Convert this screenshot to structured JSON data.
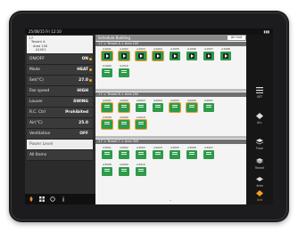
{
  "topbar": {
    "left_text": "25/08/15  Fri  12:10",
    "right_text": "▮▮▮"
  },
  "path": {
    "lines": [
      "1 F",
      "Tenant A",
      "Area 100",
      "A1001"
    ]
  },
  "settings": [
    {
      "key": "ON/OFF",
      "value": "ON"
    },
    {
      "key": "Mode",
      "value": "HEAT"
    },
    {
      "key": "Set(°C)",
      "value": "27.0"
    },
    {
      "key": "Fan speed",
      "value": "HIGH"
    },
    {
      "key": "Louver",
      "value": "SWING"
    },
    {
      "key": "R.C. Ctrl",
      "value": "Prohibited"
    },
    {
      "key": "Air(°C)",
      "value": "25.0"
    },
    {
      "key": "Ventilation",
      "value": "OFF"
    },
    {
      "key": "Power Level",
      "value": ""
    },
    {
      "key": "All Items",
      "value": ""
    }
  ],
  "main": {
    "header": "Schedule Building",
    "search_value": "All Unit",
    "sections": [
      {
        "title": "1 F  >  Tenant A  >  Area 100"
      },
      {
        "title": "1 F  >  Tenant B  >  Area 200"
      },
      {
        "title": "1 F  >  Tenant C  >  Area 300"
      }
    ],
    "units_row1": [
      "A1001",
      "A1002",
      "A1003",
      "A1004",
      "A1005",
      "A1006",
      "A1007",
      "A1008"
    ],
    "units_row2": [
      "A1009",
      "A1010"
    ],
    "units_row3": [
      "A2001",
      "A2002",
      "A2003",
      "A2004",
      "A2005",
      "A2006",
      "A2007"
    ],
    "units_row4": [
      "A2008",
      "A2009",
      "A2010"
    ],
    "units_row5": [
      "A3001",
      "A3002",
      "A3003",
      "A3004",
      "A3005",
      "A3006",
      "A3007"
    ],
    "units_row6": [
      "A3008",
      "A3009",
      "A3010"
    ]
  },
  "rightbar": [
    {
      "label": "SET",
      "icon": "menu-icon"
    },
    {
      "label": "ALL",
      "icon": "diamond-icon"
    },
    {
      "label": "Floor",
      "icon": "floor-icon"
    },
    {
      "label": "Tenant",
      "icon": "tenant-icon"
    },
    {
      "label": "Area",
      "icon": "area-icon"
    },
    {
      "label": "Unit",
      "icon": "unit-icon"
    }
  ],
  "colors": {
    "unit_green": "#2e9a4a",
    "selected": "#f0a030",
    "accent_dot": "#f0a020"
  }
}
